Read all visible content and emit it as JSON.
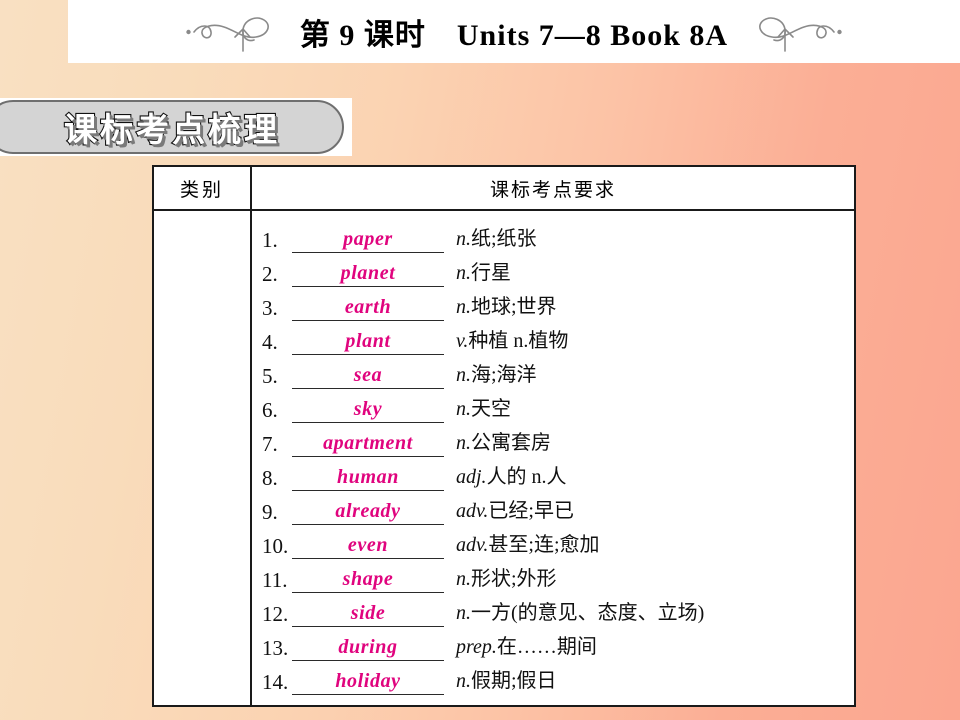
{
  "header": {
    "title": "第 9 课时　Units 7—8 Book 8A",
    "left_flourish_icon": "swirl-arrow-flourish-icon",
    "right_flourish_icon": "swirl-arrow-flourish-icon"
  },
  "badge": {
    "label": "课标考点梳理"
  },
  "table": {
    "columns": [
      "类别",
      "课标考点要求"
    ],
    "category_value": "",
    "entries": [
      {
        "num": "1.",
        "word": "paper",
        "pos": "n.",
        "meaning": "纸;纸张"
      },
      {
        "num": "2.",
        "word": "planet",
        "pos": "n.",
        "meaning": "行星"
      },
      {
        "num": "3.",
        "word": "earth",
        "pos": "n.",
        "meaning": "地球;世界"
      },
      {
        "num": "4.",
        "word": "plant",
        "pos": "v.",
        "meaning": "种植 n.植物"
      },
      {
        "num": "5.",
        "word": "sea",
        "pos": "n.",
        "meaning": "海;海洋"
      },
      {
        "num": "6.",
        "word": "sky",
        "pos": "n.",
        "meaning": "天空"
      },
      {
        "num": "7.",
        "word": "apartment",
        "pos": "n.",
        "meaning": "公寓套房"
      },
      {
        "num": "8.",
        "word": "human",
        "pos": "adj.",
        "meaning": "人的 n.人"
      },
      {
        "num": "9.",
        "word": "already",
        "pos": "adv.",
        "meaning": "已经;早已"
      },
      {
        "num": "10.",
        "word": "even",
        "pos": "adv.",
        "meaning": "甚至;连;愈加"
      },
      {
        "num": "11.",
        "word": "shape",
        "pos": "n.",
        "meaning": "形状;外形"
      },
      {
        "num": "12.",
        "word": "side",
        "pos": "n.",
        "meaning": "一方(的意见、态度、立场)"
      },
      {
        "num": "13.",
        "word": "during",
        "pos": "prep.",
        "meaning": "在……期间"
      },
      {
        "num": "14.",
        "word": "holiday",
        "pos": "n.",
        "meaning": "假期;假日"
      }
    ]
  },
  "colors": {
    "answer_word": "#e0047e",
    "badge_fill": "#d4d4d4",
    "background_left": "#f9e0c2",
    "background_right": "#fba690"
  }
}
